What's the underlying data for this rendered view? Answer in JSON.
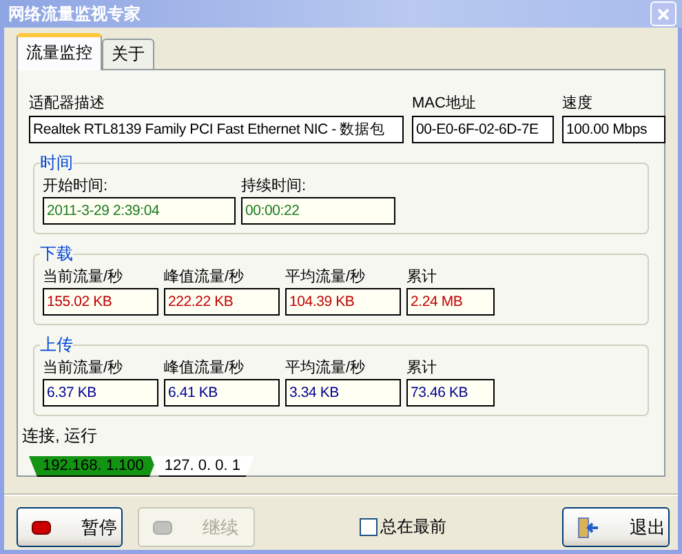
{
  "window": {
    "title": "网络流量监视专家"
  },
  "tabs": [
    {
      "label": "流量监控",
      "selected": true
    },
    {
      "label": "关于",
      "selected": false
    }
  ],
  "adapter": [
    {
      "label": "适配器描述",
      "value": "Realtek RTL8139 Family PCI Fast Ethernet NIC - 数据包"
    },
    {
      "label": "MAC地址",
      "value": "00-E0-6F-02-6D-7E"
    },
    {
      "label": "速度",
      "value": "100.00 Mbps"
    }
  ],
  "groups": [
    {
      "title": "时间",
      "kind": "time",
      "fields": [
        {
          "label": "开始时间:",
          "value": "2011-3-29 2:39:04"
        },
        {
          "label": "持续时间:",
          "value": "00:00:22"
        }
      ]
    },
    {
      "title": "下载",
      "kind": "download",
      "fields": [
        {
          "label": "当前流量/秒",
          "value": "155.02 KB"
        },
        {
          "label": "峰值流量/秒",
          "value": "222.22 KB"
        },
        {
          "label": "平均流量/秒",
          "value": "104.39 KB"
        },
        {
          "label": "累计",
          "value": "2.24 MB"
        }
      ]
    },
    {
      "title": "上传",
      "kind": "upload",
      "fields": [
        {
          "label": "当前流量/秒",
          "value": "6.37 KB"
        },
        {
          "label": "峰值流量/秒",
          "value": "6.41 KB"
        },
        {
          "label": "平均流量/秒",
          "value": "3.34 KB"
        },
        {
          "label": "累计",
          "value": "73.46 KB"
        }
      ]
    }
  ],
  "status": "连接, 运行",
  "connections": [
    {
      "label": "192.168. 1.100",
      "selected": true
    },
    {
      "label": "127. 0. 0. 1",
      "selected": false
    }
  ],
  "buttons": [
    {
      "label": "暂停",
      "kind": "pause",
      "disabled": false
    },
    {
      "label": "继续",
      "kind": "resume",
      "disabled": true
    }
  ],
  "always_on_top": {
    "label": "总在最前",
    "checked": false
  },
  "exit_button": {
    "label": "退出",
    "kind": "exit",
    "disabled": false
  }
}
